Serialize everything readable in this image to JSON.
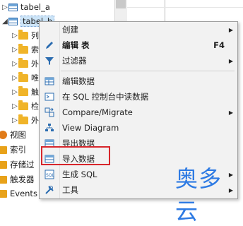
{
  "tree": {
    "top_rows": [
      {
        "label": "tabel_a",
        "icon": "table-icon",
        "expanded": false
      },
      {
        "label": "tabel_b",
        "icon": "table-icon",
        "expanded": true,
        "selected": true
      }
    ],
    "child_rows_partial": [
      "列",
      "索",
      "外",
      "唯",
      "触",
      "检",
      "外"
    ],
    "bottom_rows": [
      {
        "label": "视图",
        "icon": "view-icon"
      },
      {
        "label": "索引",
        "icon": "folder-icon"
      },
      {
        "label": "存储过",
        "icon": "folder-icon"
      },
      {
        "label": "触发器",
        "icon": "folder-icon"
      },
      {
        "label": "Events",
        "icon": "folder-icon"
      }
    ]
  },
  "menu": {
    "items": [
      {
        "label": "创建",
        "icon": "",
        "submenu": true,
        "bold": false
      },
      {
        "label": "编辑 表",
        "icon": "pencil-icon",
        "shortcut": "F4",
        "bold": true
      },
      {
        "label": "过滤器",
        "icon": "funnel-icon",
        "submenu": true
      },
      {
        "label": "编辑数据",
        "icon": "grid-icon"
      },
      {
        "label": "在 SQL 控制台中读数据",
        "icon": "console-icon"
      },
      {
        "label": "Compare/Migrate",
        "icon": "compare-icon",
        "submenu": true
      },
      {
        "label": "View Diagram",
        "icon": "diagram-icon"
      },
      {
        "label": "导出数据",
        "icon": "export-icon"
      },
      {
        "label": "导入数据",
        "icon": "import-icon"
      },
      {
        "label": "生成 SQL",
        "icon": "sql-icon",
        "submenu": true
      },
      {
        "label": "工具",
        "icon": "tools-icon",
        "submenu": true
      }
    ]
  },
  "colors": {
    "highlight_box": "#d7262b",
    "watermark": "#2d7ae3",
    "folder": "#f0b429",
    "accent_blue": "#2b6cb0"
  },
  "watermark_text": "奥多云"
}
